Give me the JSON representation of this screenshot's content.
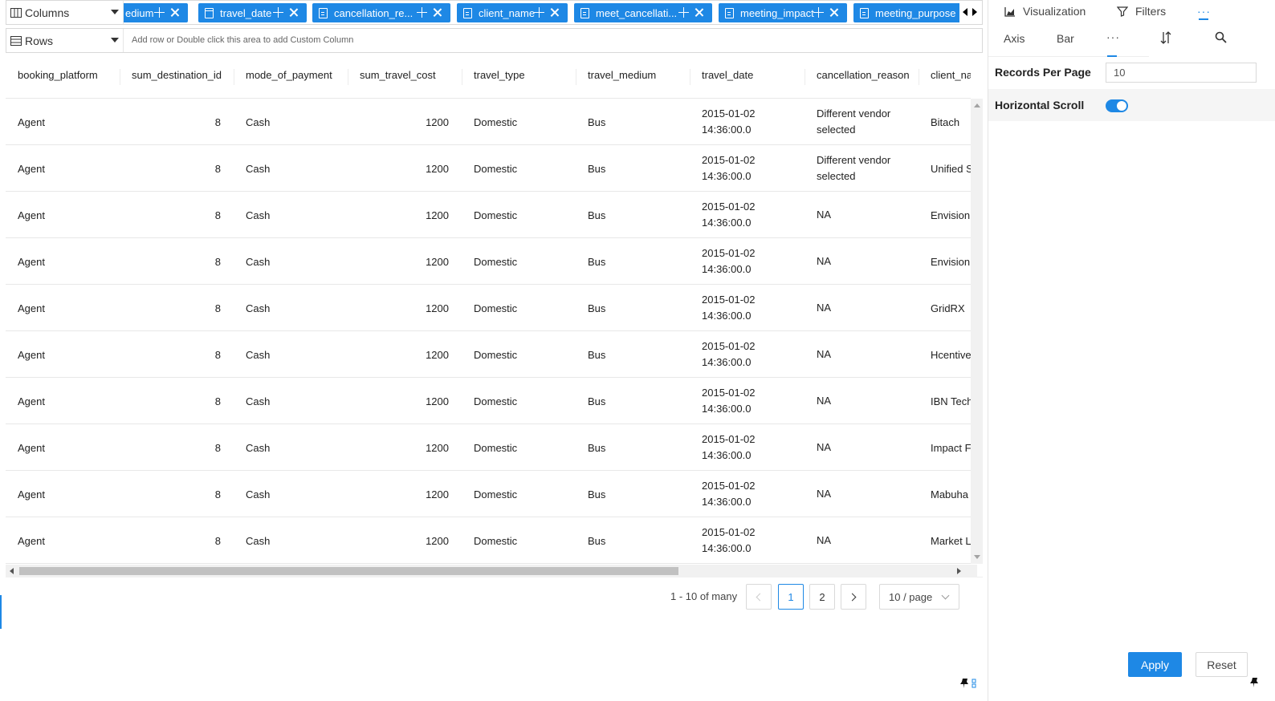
{
  "shelves": {
    "columns_label": "Columns",
    "rows_label": "Rows",
    "rows_hint": "Add row or Double click this area to add Custom Column",
    "column_pills": [
      {
        "label": "edium",
        "icon": "document-icon"
      },
      {
        "label": "travel_date",
        "icon": "calendar-icon"
      },
      {
        "label": "cancellation_re...",
        "icon": "document-icon"
      },
      {
        "label": "client_name",
        "icon": "document-icon"
      },
      {
        "label": "meet_cancellati...",
        "icon": "document-icon"
      },
      {
        "label": "meeting_impact",
        "icon": "document-icon"
      },
      {
        "label": "meeting_purpose",
        "icon": "document-icon"
      }
    ]
  },
  "table": {
    "columns": [
      "booking_platform",
      "sum_destination_id",
      "mode_of_payment",
      "sum_travel_cost",
      "travel_type",
      "travel_medium",
      "travel_date",
      "cancellation_reason",
      "client_name"
    ],
    "rows": [
      [
        "Agent",
        "8",
        "Cash",
        "1200",
        "Domestic",
        "Bus",
        "2015-01-02 14:36:00.0",
        "Different vendor selected",
        "Bitach"
      ],
      [
        "Agent",
        "8",
        "Cash",
        "1200",
        "Domestic",
        "Bus",
        "2015-01-02 14:36:00.0",
        "Different vendor selected",
        "Unified S"
      ],
      [
        "Agent",
        "8",
        "Cash",
        "1200",
        "Domestic",
        "Bus",
        "2015-01-02 14:36:00.0",
        "NA",
        "Envision"
      ],
      [
        "Agent",
        "8",
        "Cash",
        "1200",
        "Domestic",
        "Bus",
        "2015-01-02 14:36:00.0",
        "NA",
        "Envision"
      ],
      [
        "Agent",
        "8",
        "Cash",
        "1200",
        "Domestic",
        "Bus",
        "2015-01-02 14:36:00.0",
        "NA",
        "GridRX"
      ],
      [
        "Agent",
        "8",
        "Cash",
        "1200",
        "Domestic",
        "Bus",
        "2015-01-02 14:36:00.0",
        "NA",
        "Hcentive"
      ],
      [
        "Agent",
        "8",
        "Cash",
        "1200",
        "Domestic",
        "Bus",
        "2015-01-02 14:36:00.0",
        "NA",
        "IBN Tech"
      ],
      [
        "Agent",
        "8",
        "Cash",
        "1200",
        "Domestic",
        "Bus",
        "2015-01-02 14:36:00.0",
        "NA",
        "Impact F"
      ],
      [
        "Agent",
        "8",
        "Cash",
        "1200",
        "Domestic",
        "Bus",
        "2015-01-02 14:36:00.0",
        "NA",
        "Mabuha"
      ],
      [
        "Agent",
        "8",
        "Cash",
        "1200",
        "Domestic",
        "Bus",
        "2015-01-02 14:36:00.0",
        "NA",
        "Market L"
      ]
    ]
  },
  "pagination": {
    "summary": "1 - 10 of many",
    "pages": [
      "1",
      "2"
    ],
    "current_page": "1",
    "page_size": "10 / page"
  },
  "panel": {
    "tabs": {
      "visualization": "Visualization",
      "filters": "Filters",
      "more": "···"
    },
    "subtabs": {
      "axis": "Axis",
      "bar": "Bar",
      "more": "···"
    },
    "records_per_page_label": "Records Per Page",
    "records_per_page_value": "10",
    "horizontal_scroll_label": "Horizontal Scroll",
    "horizontal_scroll_on": true,
    "apply_label": "Apply",
    "reset_label": "Reset"
  },
  "colors": {
    "accent": "#1e88e5"
  }
}
